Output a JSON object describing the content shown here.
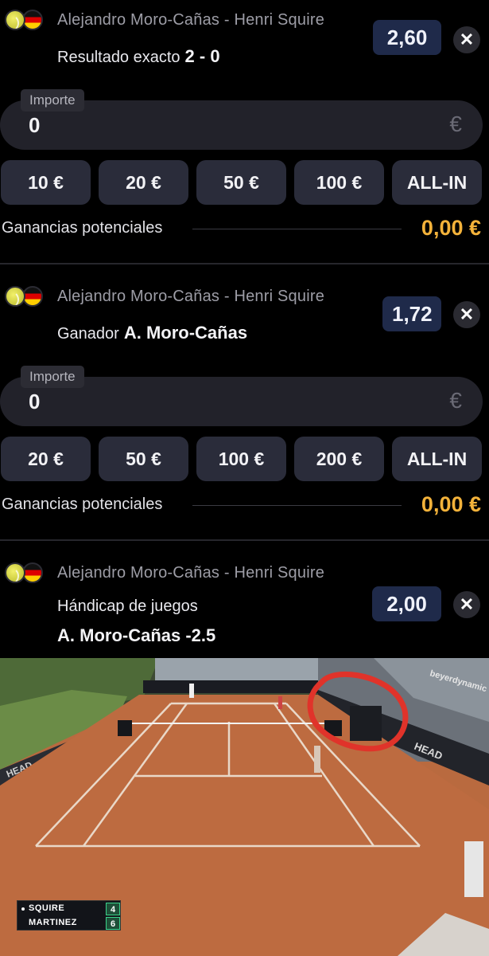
{
  "slips": [
    {
      "match": "Alejandro Moro-Cañas - Henri Squire",
      "market_label": "Resultado exacto",
      "market_value": "2 - 0",
      "odds": "2,60",
      "amount_label": "Importe",
      "amount_value": "0",
      "currency": "€",
      "quick_amounts": [
        "10 €",
        "20 €",
        "50 €",
        "100 €",
        "ALL-IN"
      ],
      "gains_label": "Ganancias potenciales",
      "gains_value": "0,00 €"
    },
    {
      "match": "Alejandro Moro-Cañas - Henri Squire",
      "market_label": "Ganador",
      "market_value": "A. Moro-Cañas",
      "odds": "1,72",
      "amount_label": "Importe",
      "amount_value": "0",
      "currency": "€",
      "quick_amounts": [
        "20 €",
        "50 €",
        "100 €",
        "200 €",
        "ALL-IN"
      ],
      "gains_label": "Ganancias potenciales",
      "gains_value": "0,00 €"
    },
    {
      "match": "Alejandro Moro-Cañas - Henri Squire",
      "market_label": "Hándicap de juegos",
      "market_value": "A. Moro-Cañas -2.5",
      "odds": "2,00"
    }
  ],
  "close_symbol": "✕",
  "video": {
    "scoreboard": [
      {
        "name": "SQUIRE",
        "games": "4",
        "serving": true
      },
      {
        "name": "MARTINEZ",
        "games": "6",
        "serving": false
      }
    ],
    "banner_text": "HEAD",
    "sponsor_text": "beyerdynamic"
  },
  "colors": {
    "background": "#000000",
    "odds_bg": "#1f2a4a",
    "chip_bg": "#2a2c3a",
    "gains": "#f3b23a",
    "clay": "#b96a3f",
    "highlight_circle": "#e0332a"
  }
}
